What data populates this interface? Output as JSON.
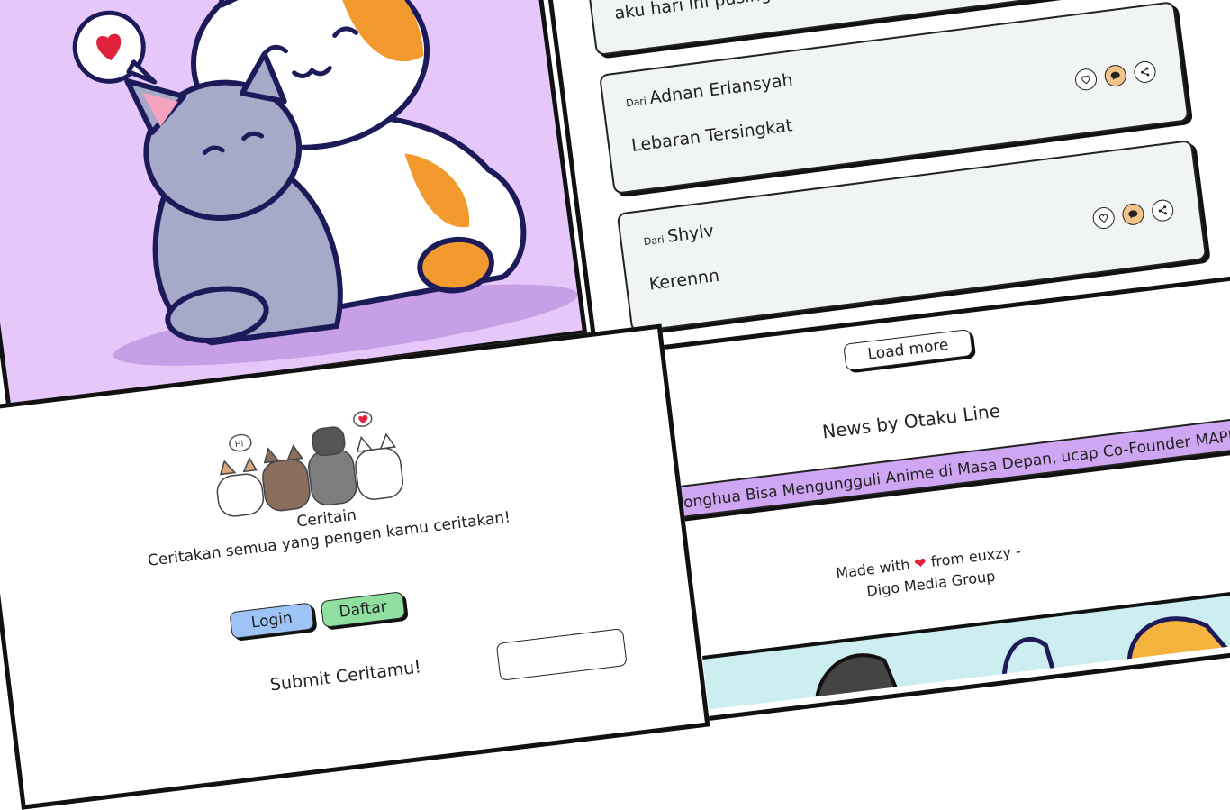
{
  "feed": {
    "cards": [
      {
        "from_prefix": "",
        "author": "",
        "message": "aku hari ini pusing"
      },
      {
        "from_prefix": "Dari",
        "author": "Adnan Erlansyah",
        "message": "Lebaran Tersingkat"
      },
      {
        "from_prefix": "Dari",
        "author": "Shylv",
        "message": "Kerennn"
      }
    ],
    "load_more_label": "Load more"
  },
  "news": {
    "title": "News by Otaku Line",
    "ticker_text": "Donghua Bisa Mengungguli Anime di Masa Depan, ucap Co-Founder MAPPA"
  },
  "footer": {
    "made_with": "Made with",
    "from_text": "from euxzy -",
    "company": "Digo Media Group"
  },
  "landing": {
    "app_name": "Ceritain",
    "tagline": "Ceritakan semua yang pengen kamu ceritakan!",
    "login_label": "Login",
    "register_label": "Daftar",
    "submit_heading": "Submit Ceritamu!",
    "bubble_hi": "Hi"
  },
  "icons": [
    "heart-icon",
    "chat-icon",
    "share-icon"
  ],
  "colors": {
    "hero_bg": "#e6c7f9",
    "card_bg": "#f0f4f2",
    "chat_btn": "#f3c48a",
    "login_btn": "#9ec4f7",
    "register_btn": "#8fe0a0",
    "ticker_bg": "#cfa6f1",
    "heart": "#e0223c"
  }
}
